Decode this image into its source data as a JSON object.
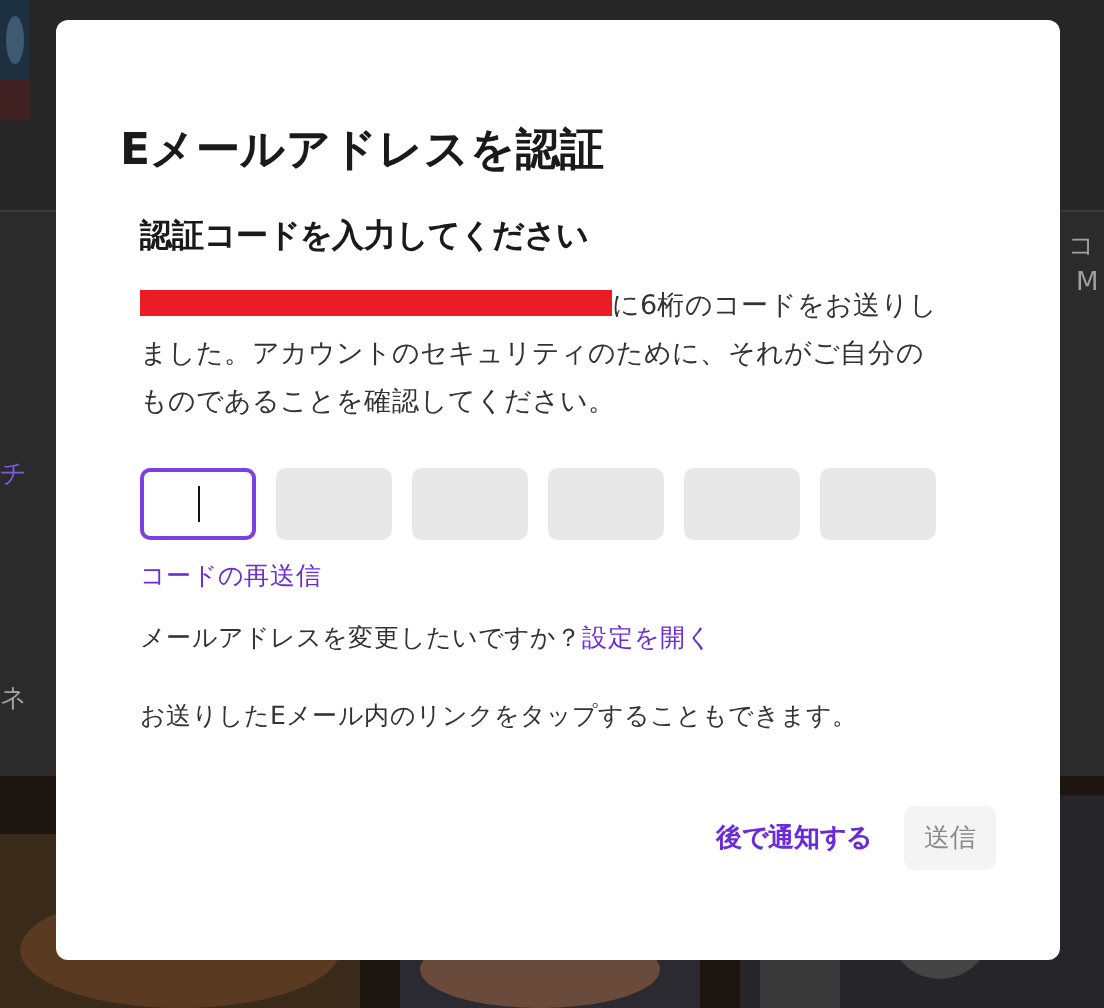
{
  "background": {
    "fragments": [
      {
        "text": "チ"
      },
      {
        "text": "ネ"
      },
      {
        "text": "コ"
      },
      {
        "text": "M"
      }
    ]
  },
  "dialog": {
    "title": "Eメールアドレスを認証",
    "subtitle": "認証コードを入力してください",
    "description": {
      "redacted": true,
      "text": "に6桁のコードをお送りしました。アカウントのセキュリティのために、それがご自分のものであることを確認してください。"
    },
    "code_inputs": [
      {
        "selected": true
      },
      {
        "selected": false
      },
      {
        "selected": false
      },
      {
        "selected": false
      },
      {
        "selected": false
      },
      {
        "selected": false
      }
    ],
    "resend_link": "コードの再送信",
    "change_prompt": "メールアドレスを変更したいですか？",
    "settings_link": "設定を開く",
    "hint": "お送りしたEメール内のリンクをタップすることもできます。",
    "buttons": [
      {
        "label": "後で通知する",
        "kind": "link",
        "disabled": false
      },
      {
        "label": "送信",
        "kind": "primary",
        "disabled": true
      }
    ]
  }
}
